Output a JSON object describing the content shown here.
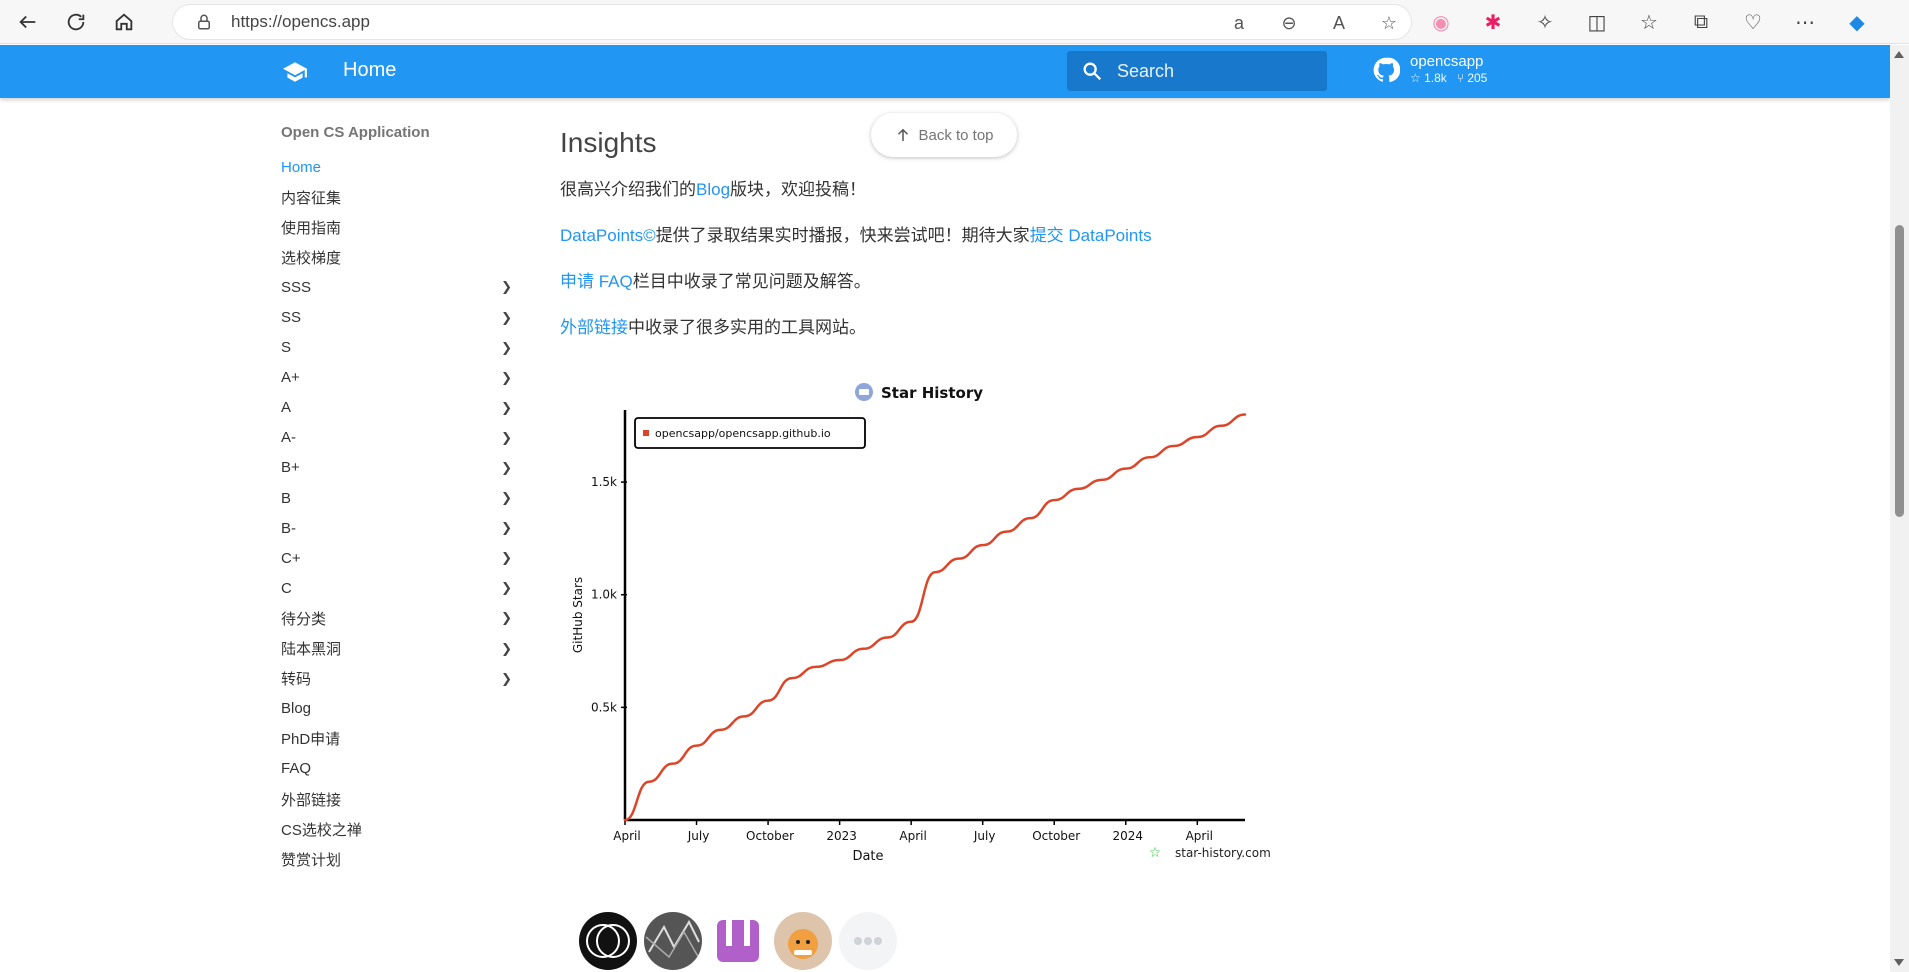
{
  "browser": {
    "url": "https://opencs.app"
  },
  "header": {
    "title": "Home",
    "search_placeholder": "Search",
    "repo_name": "opencsapp",
    "stars": "1.8k",
    "forks": "205"
  },
  "sidebar": {
    "section": "Open CS Application",
    "items": [
      {
        "label": "Home",
        "active": true,
        "chevron": false
      },
      {
        "label": "内容征集",
        "chevron": false
      },
      {
        "label": "使用指南",
        "chevron": false
      },
      {
        "label": "选校梯度",
        "chevron": false
      },
      {
        "label": "SSS",
        "chevron": true
      },
      {
        "label": "SS",
        "chevron": true
      },
      {
        "label": "S",
        "chevron": true
      },
      {
        "label": "A+",
        "chevron": true
      },
      {
        "label": "A",
        "chevron": true
      },
      {
        "label": "A-",
        "chevron": true
      },
      {
        "label": "B+",
        "chevron": true
      },
      {
        "label": "B",
        "chevron": true
      },
      {
        "label": "B-",
        "chevron": true
      },
      {
        "label": "C+",
        "chevron": true
      },
      {
        "label": "C",
        "chevron": true
      },
      {
        "label": "待分类",
        "chevron": true
      },
      {
        "label": "陆本黑洞",
        "chevron": true
      },
      {
        "label": "转码",
        "chevron": true
      },
      {
        "label": "Blog",
        "chevron": false
      },
      {
        "label": "PhD申请",
        "chevron": false
      },
      {
        "label": "FAQ",
        "chevron": false
      },
      {
        "label": "外部链接",
        "chevron": false
      },
      {
        "label": "CS选校之禅",
        "chevron": false
      },
      {
        "label": "赞赏计划",
        "chevron": false
      }
    ]
  },
  "content": {
    "title": "Insights",
    "back_to_top": "Back to top",
    "p1_pre": "很高兴介绍我们的",
    "p1_link": "Blog",
    "p1_post": "版块，欢迎投稿！",
    "p2_link1": "DataPoints©",
    "p2_mid": "提供了录取结果实时播报，快来尝试吧！期待大家",
    "p2_link2": "提交 DataPoints",
    "p3_link": "申请 FAQ",
    "p3_post": "栏目中收录了常见问题及解答。",
    "p4_link": "外部链接",
    "p4_post": "中收录了很多实用的工具网站。"
  },
  "colors": {
    "brand": "#2196f3",
    "line": "#dd4528"
  },
  "chart_data": {
    "type": "line",
    "title": "Star History",
    "xlabel": "Date",
    "ylabel": "GitHub Stars",
    "watermark": "star-history.com",
    "legend": "opencsapp/opencsapp.github.io",
    "legend_position": "top-left",
    "x_ticks": [
      "April",
      "July",
      "October",
      "2023",
      "April",
      "July",
      "October",
      "2024",
      "April"
    ],
    "y_ticks": [
      "0.5k",
      "1.0k",
      "1.5k"
    ],
    "ylim": [
      0,
      1820
    ],
    "series": [
      {
        "name": "opencsapp/opencsapp.github.io",
        "x": [
          "2022-04",
          "2022-05",
          "2022-06",
          "2022-07",
          "2022-08",
          "2022-09",
          "2022-10",
          "2022-11",
          "2022-12",
          "2023-01",
          "2023-02",
          "2023-03",
          "2023-04",
          "2023-05",
          "2023-06",
          "2023-07",
          "2023-08",
          "2023-09",
          "2023-10",
          "2023-11",
          "2023-12",
          "2024-01",
          "2024-02",
          "2024-03",
          "2024-04",
          "2024-05",
          "2024-06"
        ],
        "values": [
          0,
          170,
          250,
          330,
          400,
          460,
          530,
          630,
          680,
          710,
          760,
          810,
          880,
          1100,
          1160,
          1220,
          1280,
          1340,
          1420,
          1470,
          1510,
          1560,
          1610,
          1660,
          1700,
          1750,
          1800
        ]
      }
    ]
  }
}
